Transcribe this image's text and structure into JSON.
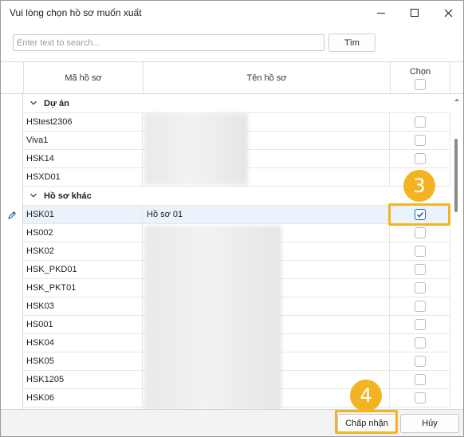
{
  "window": {
    "title": "Vui lòng chọn hồ sơ muốn xuất"
  },
  "search": {
    "placeholder": "Enter text to search...",
    "value": "",
    "button_label": "Tìm"
  },
  "grid": {
    "columns": {
      "ma": "Mã hồ sơ",
      "ten": "Tên hồ sơ",
      "chon": "Chọn"
    },
    "groups": [
      {
        "label": "Dự án",
        "rows": [
          {
            "ma": "HStest2306",
            "ten": "",
            "checked": false
          },
          {
            "ma": "Viva1",
            "ten": "",
            "checked": false
          },
          {
            "ma": "HSK14",
            "ten": "",
            "checked": false
          },
          {
            "ma": "HSXD01",
            "ten": "",
            "checked": false
          }
        ]
      },
      {
        "label": "Hồ sơ khác",
        "rows": [
          {
            "ma": "HSK01",
            "ten": "Hồ sơ 01",
            "checked": true
          },
          {
            "ma": "HS002",
            "ten": "",
            "checked": false
          },
          {
            "ma": "HSK02",
            "ten": "",
            "checked": false
          },
          {
            "ma": "HSK_PKD01",
            "ten": "",
            "checked": false
          },
          {
            "ma": "HSK_PKT01",
            "ten": "",
            "checked": false
          },
          {
            "ma": "HSK03",
            "ten": "",
            "checked": false
          },
          {
            "ma": "HS001",
            "ten": "",
            "checked": false
          },
          {
            "ma": "HSK04",
            "ten": "",
            "checked": false
          },
          {
            "ma": "HSK05",
            "ten": "",
            "checked": false
          },
          {
            "ma": "HSK1205",
            "ten": "",
            "checked": false
          },
          {
            "ma": "HSK06",
            "ten": "",
            "checked": false
          }
        ]
      }
    ]
  },
  "annotations": {
    "step_checkbox": "3",
    "step_accept": "4",
    "highlight_color": "#f4b323"
  },
  "footer": {
    "accept_label": "Chấp nhận",
    "cancel_label": "Hủy"
  },
  "colors": {
    "selected_row": "#eaf3fb",
    "check_accent": "#1f5fa8"
  }
}
